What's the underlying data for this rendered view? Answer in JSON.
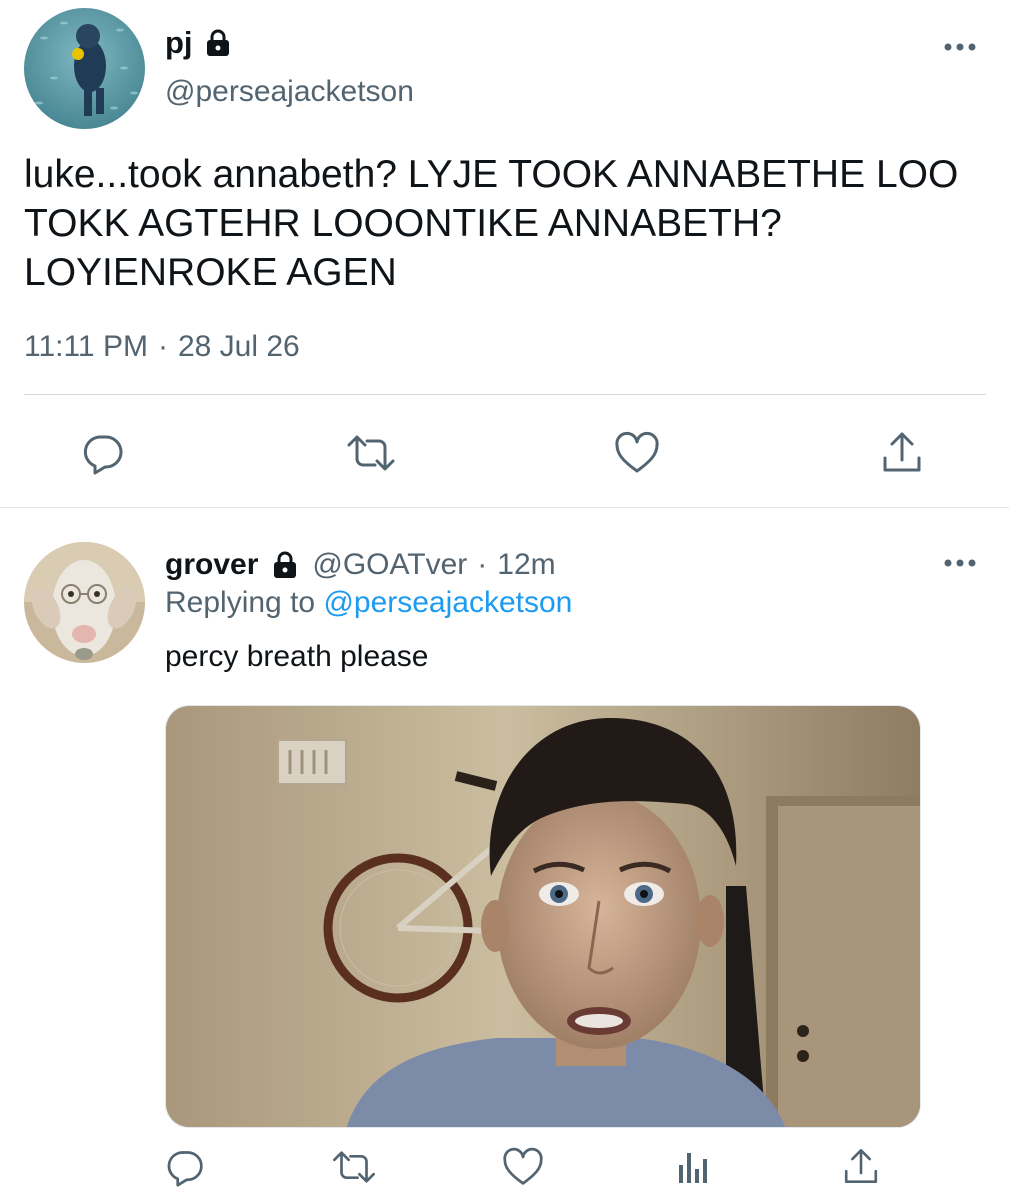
{
  "main_tweet": {
    "display_name": "pj",
    "handle": "@perseajacketson",
    "protected": true,
    "text": "luke...took annabeth? LYJE TOOK ANNABETHE LOO TOKK AGTEHR LOOONTIKE ANNABETH? LOYIENROKE AGEN",
    "time": "11:11 PM",
    "separator": "·",
    "date": "28 Jul 26",
    "actions": [
      "reply-icon",
      "retweet-icon",
      "like-icon",
      "share-icon"
    ]
  },
  "reply_tweet": {
    "display_name": "grover",
    "handle": "@GOATver",
    "separator": "·",
    "age": "12m",
    "protected": true,
    "replying_prefix": "Replying to",
    "replying_to": "@perseajacketson",
    "text": "percy breath please",
    "actions": [
      "reply-icon",
      "retweet-icon",
      "like-icon",
      "analytics-icon",
      "share-icon"
    ]
  },
  "colors": {
    "text_primary": "#0f1419",
    "text_secondary": "#536471",
    "link": "#1d9bf0",
    "divider": "#cfd9de"
  }
}
